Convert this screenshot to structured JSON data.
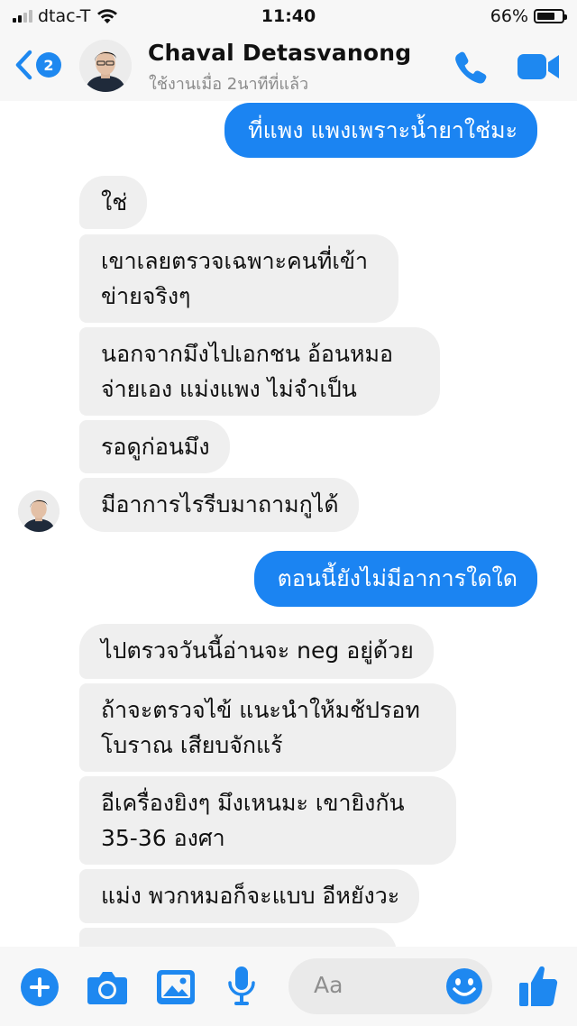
{
  "status_bar": {
    "carrier": "dtac-T",
    "time": "11:40",
    "battery": "66%",
    "signal_bars": 2
  },
  "header": {
    "back_badge": "2",
    "contact_name": "Chaval Detasvanong",
    "contact_status": "ใช้งานเมื่อ 2นาทีที่แล้ว"
  },
  "messages": [
    {
      "side": "out",
      "text": "ที่แพง แพงเพราะน้ำยาใช่มะ"
    },
    {
      "side": "in",
      "text": "ใช่"
    },
    {
      "side": "in",
      "text": "เขาเลยตรวจเฉพาะคนที่เข้า ข่ายจริงๆ"
    },
    {
      "side": "in",
      "text": "นอกจากมึงไปเอกชน อ้อนหมอ จ่ายเอง แม่งแพง ไม่จำเป็น"
    },
    {
      "side": "in",
      "text": "รอดูก่อนมึง"
    },
    {
      "side": "in",
      "text": "มีอาการไรรีบมาถามกูได้"
    },
    {
      "side": "out",
      "text": "ตอนนี้ยังไม่มีอาการใดใด"
    },
    {
      "side": "in",
      "text": "ไปตรวจวันนี้อ่านจะ neg อยู่ด้วย"
    },
    {
      "side": "in",
      "text": "ถ้าจะตรวจไข้ แนะนำให้มช้ปรอท โบราณ เสียบจักแร้"
    },
    {
      "side": "in",
      "text": "อีเครื่องยิงๆ มึงเหนมะ เขายิงกัน 35-36 องศา"
    },
    {
      "side": "in",
      "text": "แม่ง พวกหมอก็จะแบบ อีหยังวะ"
    }
  ],
  "composer": {
    "placeholder": "Aa"
  },
  "colors": {
    "accent": "#1b84f2",
    "incoming_bubble": "#efefef",
    "bar_background": "#f7f7f7"
  },
  "icons": [
    "signal-icon",
    "wifi-icon",
    "battery-icon",
    "back-chevron-icon",
    "phone-icon",
    "video-camera-icon",
    "plus-icon",
    "camera-icon",
    "image-icon",
    "microphone-icon",
    "emoji-icon",
    "thumbs-up-icon"
  ]
}
